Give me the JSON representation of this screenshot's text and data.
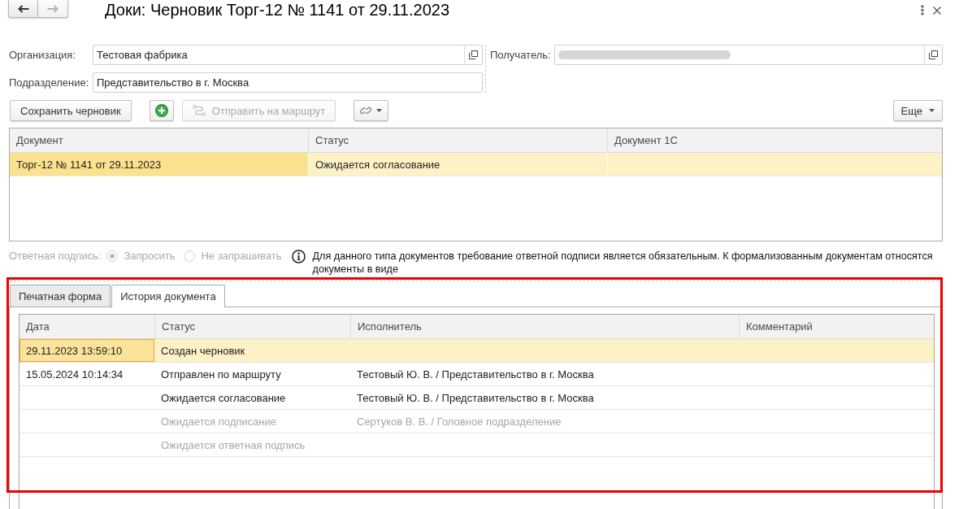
{
  "window": {
    "title": "Доки: Черновик Торг-12 № 1141 от 29.11.2023",
    "nav": [
      {
        "kind": "back",
        "disabled": false
      },
      {
        "kind": "forward",
        "disabled": true
      }
    ]
  },
  "fields": {
    "left": [
      {
        "label": "Организация:",
        "value": "Тестовая фабрика",
        "open_button": true
      },
      {
        "label": "Подразделение:",
        "value": "Представительство в г. Москва",
        "open_button": false
      }
    ],
    "right": [
      {
        "label": "Получатель:",
        "redacted": true,
        "open_button": true
      }
    ]
  },
  "toolbar": {
    "buttons": [
      {
        "kind": "save",
        "label": "Сохранить черновик",
        "disabled": false
      },
      {
        "kind": "add",
        "disabled": false
      },
      {
        "kind": "route",
        "label": "Отправить на маршрут",
        "disabled": true
      },
      {
        "kind": "link-menu",
        "disabled": false
      }
    ],
    "more": {
      "label": "Еще"
    }
  },
  "documents": {
    "columns": [
      "Документ",
      "Статус",
      "Документ 1С"
    ],
    "rows": [
      {
        "cells": [
          "Торг-12 № 1141 от 29.11.2023",
          "Ожидается согласование"
        ],
        "selected": true
      }
    ]
  },
  "response_signature": {
    "label": "Ответная подпись:",
    "disabled": true,
    "options": [
      {
        "label": "Запросить",
        "selected": true
      },
      {
        "label": "Не запрашивать",
        "selected": false
      }
    ],
    "note": "Для данного типа документов требование ответной подписи является обязательным. К формализованным документам относятся документы в виде"
  },
  "tabs": [
    {
      "label": "Печатная форма",
      "selected": false
    },
    {
      "label": "История документа",
      "selected": true
    }
  ],
  "history": {
    "columns": [
      "Дата",
      "Статус",
      "Исполнитель",
      "Комментарий"
    ],
    "rows": [
      {
        "date": "29.11.2023 13:59:10",
        "status": "Создан черновик",
        "selected": true,
        "pending": false
      },
      {
        "date": "15.05.2024 10:14:34",
        "status": "Отправлен по маршруту",
        "performer": "Тестовый Ю. В. / Представительство в г. Москва",
        "selected": false,
        "pending": false
      },
      {
        "status": "Ожидается согласование",
        "performer": "Тестовый Ю. В. / Представительство в г. Москва",
        "selected": false,
        "pending": false
      },
      {
        "status": "Ожидается подписание",
        "performer": "Сертуков В. В. / Головное подразделение",
        "selected": false,
        "pending": true
      },
      {
        "status": "Ожидается ответная подпись",
        "selected": false,
        "pending": true
      }
    ]
  },
  "annotations": [
    {
      "kind": "frame"
    }
  ]
}
